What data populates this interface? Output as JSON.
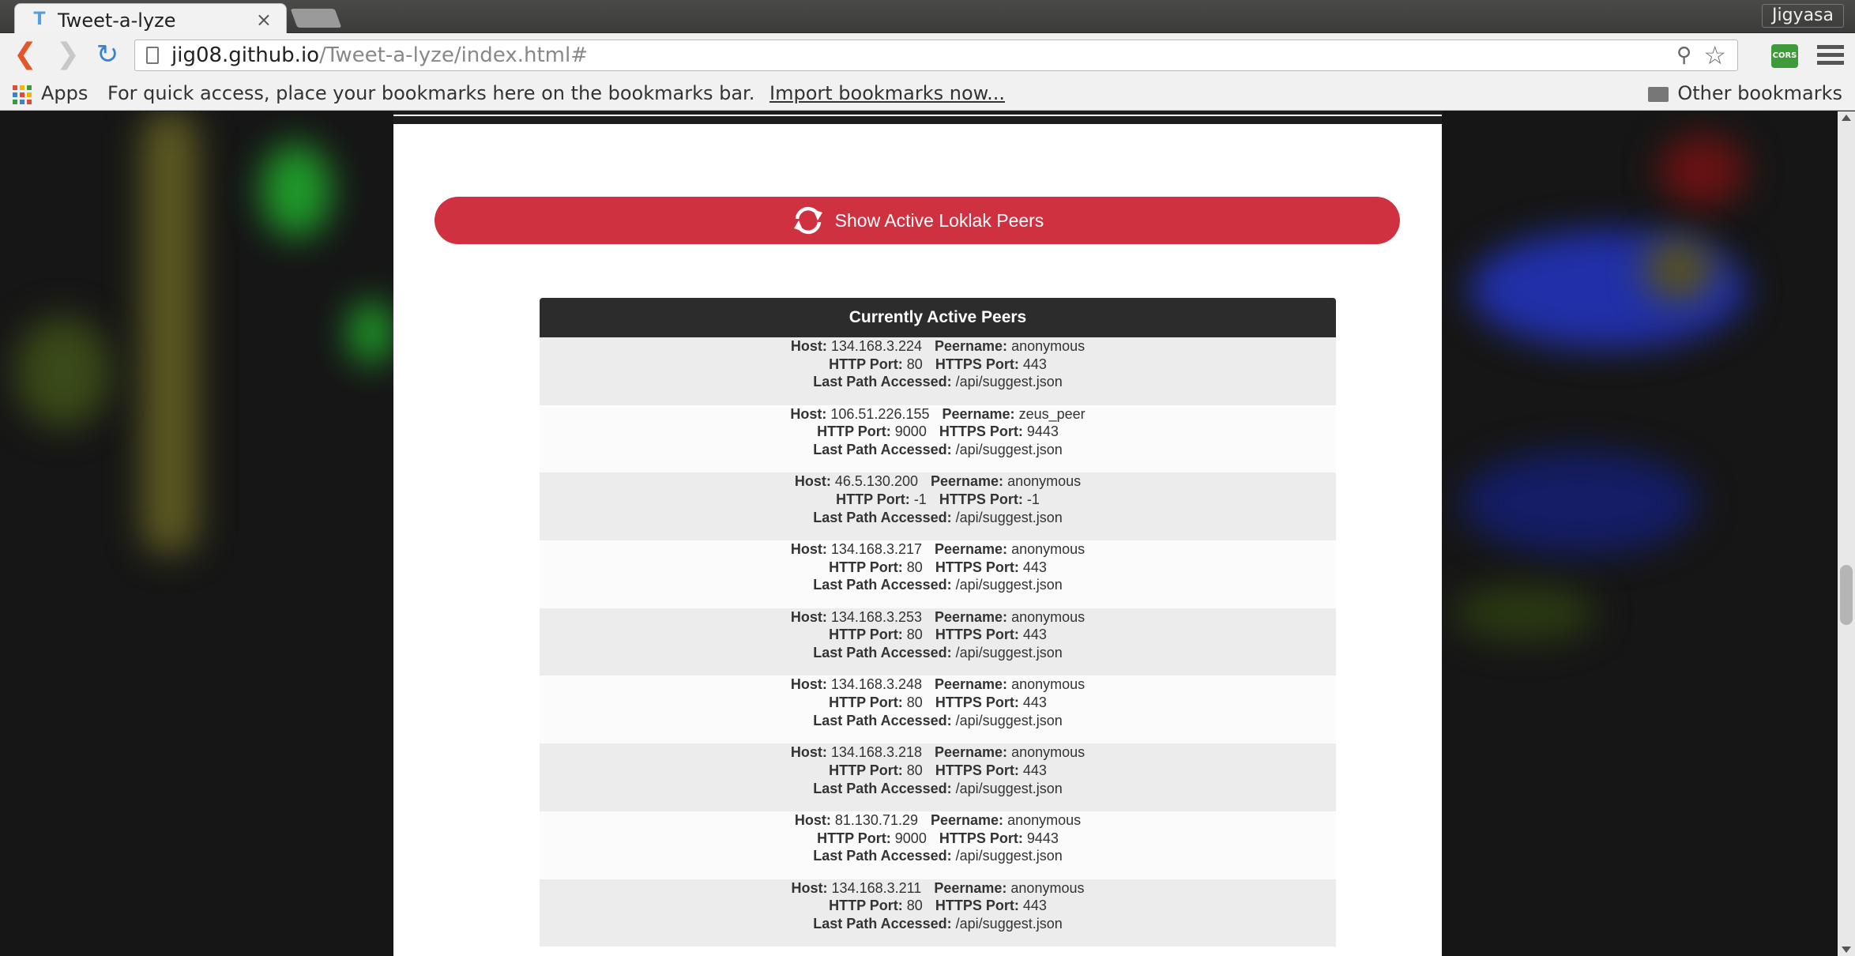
{
  "browser": {
    "tab_title": "Tweet-a-lyze",
    "tab_close": "×",
    "profile_name": "Jigyasa",
    "url_domain": "jig08.github.io",
    "url_path": "/Tweet-a-lyze/index.html#",
    "extension_label": "CORS",
    "bookmarks_bar": {
      "apps_label": "Apps",
      "message": "For quick access, place your bookmarks here on the bookmarks bar.",
      "import_link": "Import bookmarks now...",
      "other_bookmarks": "Other bookmarks"
    },
    "colors": {
      "back_arrow": "#e2572a",
      "reload": "#3c83cf",
      "cors_badge": "#3f9a3a"
    }
  },
  "page": {
    "button_label": "Show Active Loklak Peers",
    "button_color": "#cf3140",
    "table_title": "Currently Active Peers",
    "field_labels": {
      "host": "Host:",
      "peername": "Peername:",
      "http_port": "HTTP Port:",
      "https_port": "HTTPS Port:",
      "last_path": "Last Path Accessed:"
    },
    "peers": [
      {
        "host": "134.168.3.224",
        "peername": "anonymous",
        "http_port": "80",
        "https_port": "443",
        "last_path": "/api/suggest.json"
      },
      {
        "host": "106.51.226.155",
        "peername": "zeus_peer",
        "http_port": "9000",
        "https_port": "9443",
        "last_path": "/api/suggest.json"
      },
      {
        "host": "46.5.130.200",
        "peername": "anonymous",
        "http_port": "-1",
        "https_port": "-1",
        "last_path": "/api/suggest.json"
      },
      {
        "host": "134.168.3.217",
        "peername": "anonymous",
        "http_port": "80",
        "https_port": "443",
        "last_path": "/api/suggest.json"
      },
      {
        "host": "134.168.3.253",
        "peername": "anonymous",
        "http_port": "80",
        "https_port": "443",
        "last_path": "/api/suggest.json"
      },
      {
        "host": "134.168.3.248",
        "peername": "anonymous",
        "http_port": "80",
        "https_port": "443",
        "last_path": "/api/suggest.json"
      },
      {
        "host": "134.168.3.218",
        "peername": "anonymous",
        "http_port": "80",
        "https_port": "443",
        "last_path": "/api/suggest.json"
      },
      {
        "host": "81.130.71.29",
        "peername": "anonymous",
        "http_port": "9000",
        "https_port": "9443",
        "last_path": "/api/suggest.json"
      },
      {
        "host": "134.168.3.211",
        "peername": "anonymous",
        "http_port": "80",
        "https_port": "443",
        "last_path": "/api/suggest.json"
      }
    ]
  }
}
